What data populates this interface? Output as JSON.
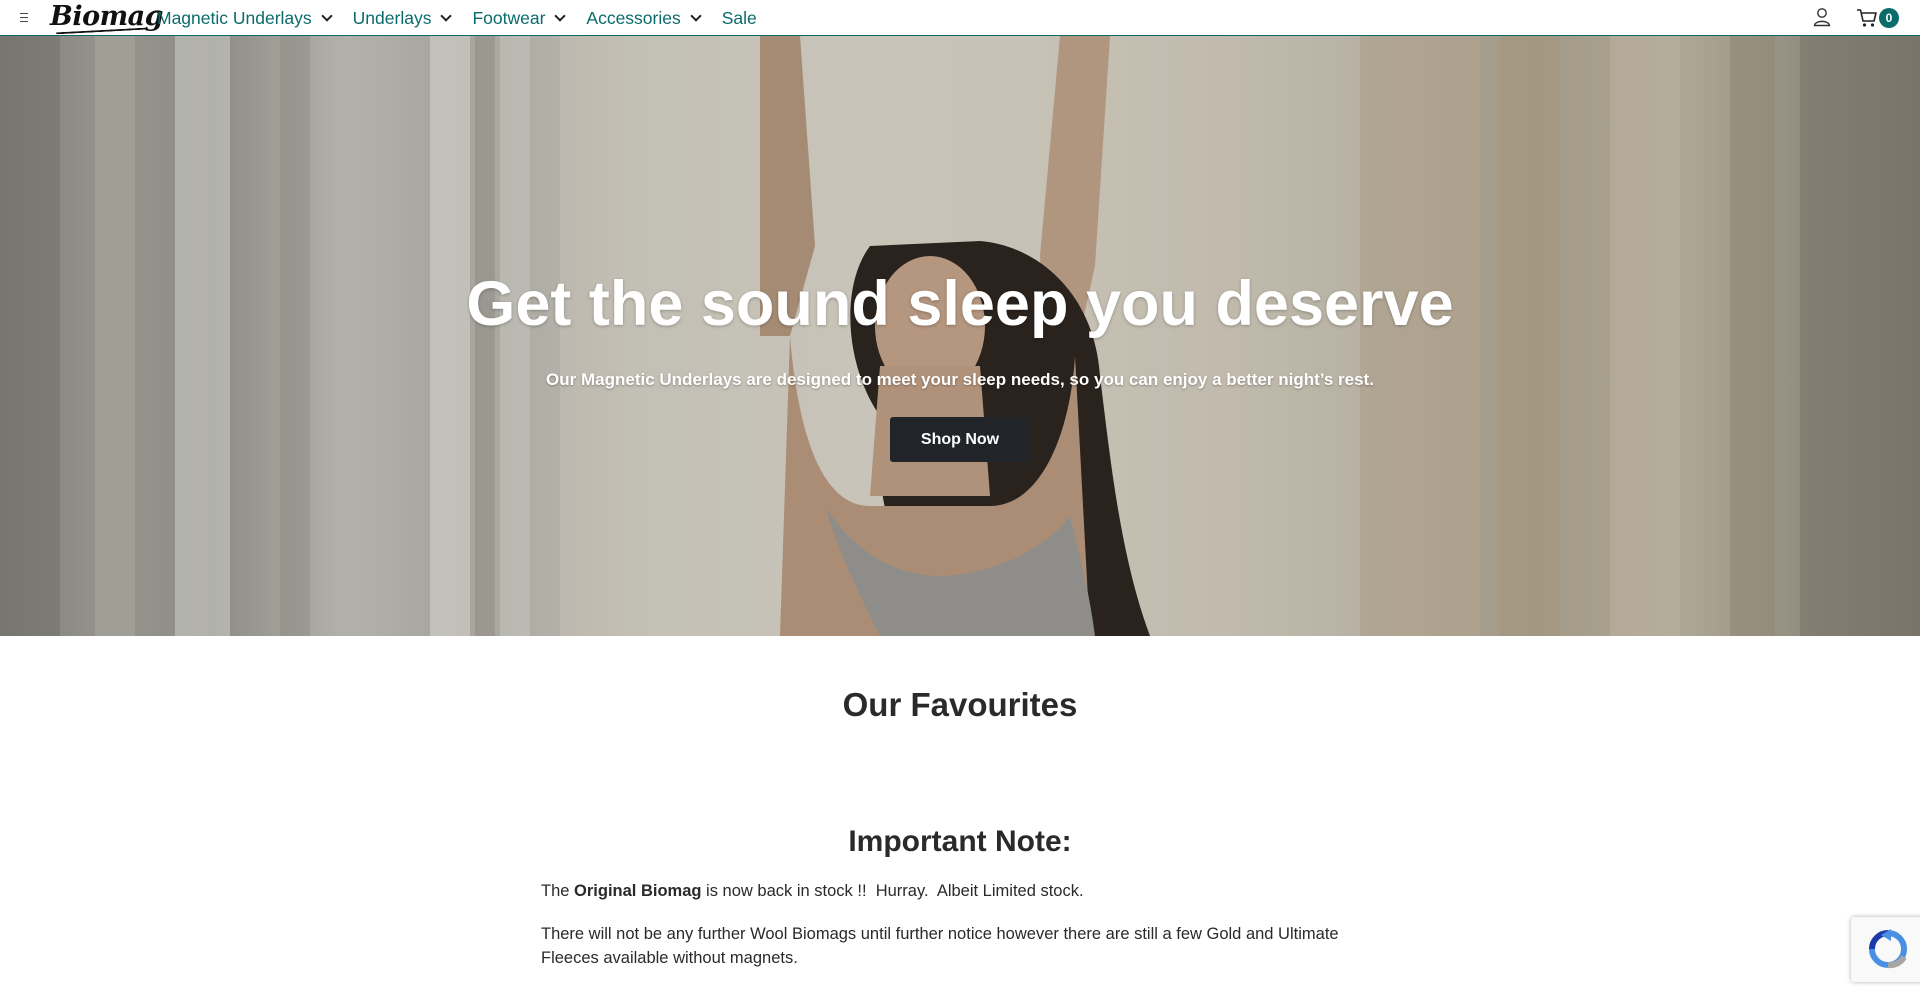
{
  "nav": {
    "logo": "Biomag",
    "menu": [
      {
        "label": "Magnetic Underlays",
        "has_dropdown": true
      },
      {
        "label": "Underlays",
        "has_dropdown": true
      },
      {
        "label": "Footwear",
        "has_dropdown": true
      },
      {
        "label": "Accessories",
        "has_dropdown": true
      },
      {
        "label": "Sale",
        "has_dropdown": false
      }
    ],
    "cart_count": "0",
    "accent_color": "#0b6b6b"
  },
  "hero": {
    "title": "Get the sound sleep you deserve",
    "subtitle": "Our Magnetic Underlays are designed to meet your sleep needs, so you can enjoy a better night’s rest.",
    "cta_label": "Shop Now"
  },
  "favourites": {
    "title": "Our Favourites"
  },
  "note": {
    "title": "Important Note:",
    "p1_prefix": "The ",
    "p1_bold": "Original Biomag",
    "p1_suffix": " is now back in stock !!  Hurray.  Albeit Limited stock.",
    "p2": "There will not be any further Wool Biomags until further notice however there are still a few Gold and Ultimate Fleeces available without magnets."
  }
}
